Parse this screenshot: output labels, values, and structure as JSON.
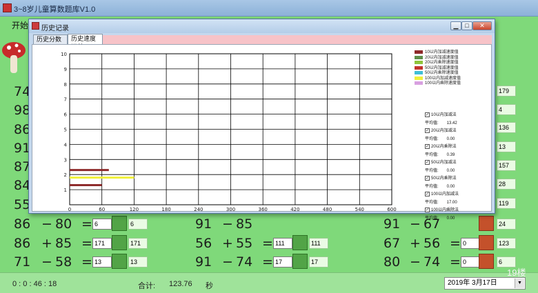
{
  "main_window": {
    "title": "3~8岁儿童算数题库V1.0",
    "menu": [
      "开始"
    ]
  },
  "left_numbers": [
    "74",
    "98",
    "86",
    "91",
    "87",
    "84",
    "55"
  ],
  "right_answers": [
    "179",
    "4",
    "136",
    "13",
    "157",
    "28",
    "119"
  ],
  "problems": [
    {
      "a": "86",
      "op": "−",
      "b": "80",
      "eq": "=",
      "answer": "6",
      "result": "6",
      "status": "correct"
    },
    {
      "a": "86",
      "op": "+",
      "b": "85",
      "eq": "=",
      "answer": "171",
      "result": "171",
      "status": "correct"
    },
    {
      "a": "71",
      "op": "−",
      "b": "58",
      "eq": "=",
      "answer": "13",
      "result": "13",
      "status": "correct"
    },
    {
      "a": "91",
      "op": "−",
      "b": "85",
      "eq": "=",
      "answer": "",
      "result": "",
      "status": "correct"
    },
    {
      "a": "56",
      "op": "+",
      "b": "55",
      "eq": "=",
      "answer": "111",
      "result": "111",
      "status": "correct"
    },
    {
      "a": "91",
      "op": "−",
      "b": "74",
      "eq": "=",
      "answer": "17",
      "result": "17",
      "status": "correct"
    },
    {
      "a": "91",
      "op": "−",
      "b": "67",
      "eq": "=",
      "answer": "",
      "result": "24",
      "status": "wrong"
    },
    {
      "a": "67",
      "op": "+",
      "b": "56",
      "eq": "=",
      "answer": "0",
      "result": "123",
      "status": "wrong"
    },
    {
      "a": "80",
      "op": "−",
      "b": "74",
      "eq": "=",
      "answer": "0",
      "result": "6",
      "status": "wrong"
    }
  ],
  "statusbar": {
    "timer": "0 : 0 : 46 : 18",
    "total_label": "合计:",
    "total_value": "123.76",
    "unit": "秒",
    "date": "2019年 3月17日",
    "watermark": "19楼"
  },
  "dialog": {
    "title": "历史记录",
    "tabs": [
      "历史分数汇总",
      "历史速度汇总"
    ],
    "active_tab": 1,
    "controls": {
      "minimize": "▁",
      "maximize": "□",
      "close": "✕"
    }
  },
  "legend": [
    {
      "label": "10以内加减速度值",
      "color": "#8e2a2a"
    },
    {
      "label": "20以内加减速度值",
      "color": "#5e8f4a"
    },
    {
      "label": "20以内乘除速度值",
      "color": "#8fc43c"
    },
    {
      "label": "50以内加减速度值",
      "color": "#c2322b"
    },
    {
      "label": "50以内乘除速度值",
      "color": "#3fbfd8"
    },
    {
      "label": "100以内加减速度值",
      "color": "#f0f03a"
    },
    {
      "label": "100以内乘除速度值",
      "color": "#d8a0e0"
    }
  ],
  "stats": [
    {
      "check": "10以内加减法",
      "avg_label": "平均值:",
      "avg": "13.42"
    },
    {
      "check": "20以内加减法",
      "avg_label": "平均值:",
      "avg": "0.00"
    },
    {
      "check": "20以内乘除法",
      "avg_label": "平均值:",
      "avg": "0.39"
    },
    {
      "check": "50以内加减法",
      "avg_label": "平均值:",
      "avg": "0.00"
    },
    {
      "check": "50以内乘除法",
      "avg_label": "平均值:",
      "avg": "0.00"
    },
    {
      "check": "100以内加减法",
      "avg_label": "平均值:",
      "avg": "17.00"
    },
    {
      "check": "100以内乘除法",
      "avg_label": "平均值:",
      "avg": "0.00"
    }
  ],
  "chart_data": {
    "type": "bar",
    "orientation": "horizontal",
    "xlim": [
      0,
      600
    ],
    "ylim": [
      0,
      10
    ],
    "x_ticks": [
      0,
      60,
      120,
      180,
      240,
      300,
      360,
      420,
      480,
      540,
      600
    ],
    "y_ticks": [
      1,
      2,
      3,
      4,
      5,
      6,
      7,
      8,
      9,
      10
    ],
    "grid": true,
    "legend_position": "right",
    "bars": [
      {
        "y": 1.3,
        "value": 60,
        "color": "#8e2a2a"
      },
      {
        "y": 1.8,
        "value": 120,
        "color": "#f0f03a"
      },
      {
        "y": 2.3,
        "value": 73,
        "color": "#8e2a2a"
      }
    ]
  }
}
